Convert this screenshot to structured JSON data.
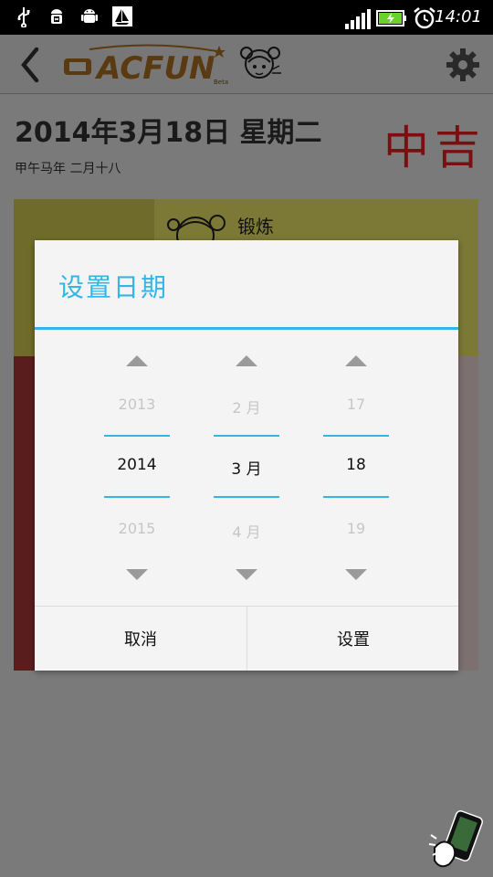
{
  "status_bar": {
    "time": "14:01",
    "icons": [
      "usb-icon",
      "android-debug-icon",
      "android-icon",
      "sailboat-icon",
      "signal-icon",
      "battery-charging-icon",
      "alarm-icon"
    ]
  },
  "app_bar": {
    "logo_text": "ACFUN",
    "logo_sub": "Beta",
    "icons": [
      "back-icon",
      "settings-gear-icon"
    ]
  },
  "header": {
    "date": "2014年3月18日 星期二",
    "lunar": "甲午马年 二月十八",
    "fortune": "中吉"
  },
  "card": {
    "title": "锻炼"
  },
  "dialog": {
    "title": "设置日期",
    "columns": [
      {
        "name": "year",
        "prev": "2013",
        "current": "2014",
        "next": "2015"
      },
      {
        "name": "month",
        "prev": "2 月",
        "current": "3 月",
        "next": "4 月"
      },
      {
        "name": "day",
        "prev": "17",
        "current": "18",
        "next": "19"
      }
    ],
    "cancel_label": "取消",
    "set_label": "设置"
  },
  "colors": {
    "accent": "#33b5e5",
    "fortune_red": "#7b0f0f"
  }
}
